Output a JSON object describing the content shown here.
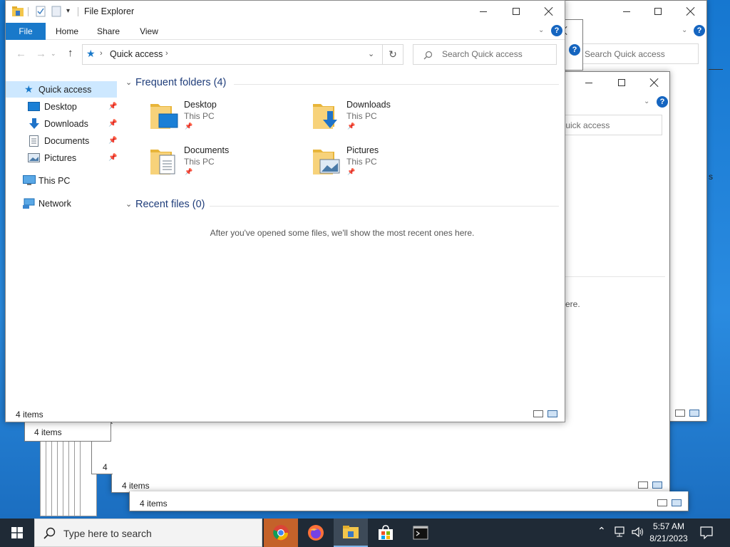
{
  "window": {
    "title": "File Explorer",
    "help": "?"
  },
  "ribbon": {
    "tabs": [
      "File",
      "Home",
      "Share",
      "View"
    ]
  },
  "address": {
    "location": "Quick access"
  },
  "search": {
    "placeholder": "Search Quick access"
  },
  "nav": {
    "items": [
      {
        "label": "Quick access",
        "icon": "star-icon",
        "selected": true
      },
      {
        "label": "Desktop",
        "icon": "desktop-icon",
        "pinned": true
      },
      {
        "label": "Downloads",
        "icon": "download-arrow-icon",
        "pinned": true
      },
      {
        "label": "Documents",
        "icon": "document-icon",
        "pinned": true
      },
      {
        "label": "Pictures",
        "icon": "pictures-icon",
        "pinned": true
      },
      {
        "label": "This PC",
        "icon": "monitor-icon"
      },
      {
        "label": "Network",
        "icon": "network-icon"
      }
    ]
  },
  "content": {
    "frequent_header": "Frequent folders (4)",
    "recent_header": "Recent files (0)",
    "recent_empty": "After you've opened some files, we'll show the most recent ones here.",
    "folders": [
      {
        "name": "Desktop",
        "location": "This PC"
      },
      {
        "name": "Downloads",
        "location": "This PC"
      },
      {
        "name": "Documents",
        "location": "This PC"
      },
      {
        "name": "Pictures",
        "location": "This PC"
      }
    ]
  },
  "status": {
    "item_count": "4 items"
  },
  "background_windows": {
    "search_placeholder": "Search Quick access",
    "search_partial": "ch Quick access",
    "partial_text_1": "ere.",
    "partial_text_2": "s",
    "item_count": "4 items",
    "partial_count": "4"
  },
  "taskbar": {
    "search_placeholder": "Type here to search",
    "apps": [
      "chrome-icon",
      "firefox-icon",
      "file-explorer-icon",
      "store-icon",
      "terminal-icon"
    ],
    "time": "5:57 AM",
    "date": "8/21/2023"
  },
  "colors": {
    "accent": "#1979ca",
    "selection": "#cde8ff",
    "group_header": "#1f3d7a"
  }
}
